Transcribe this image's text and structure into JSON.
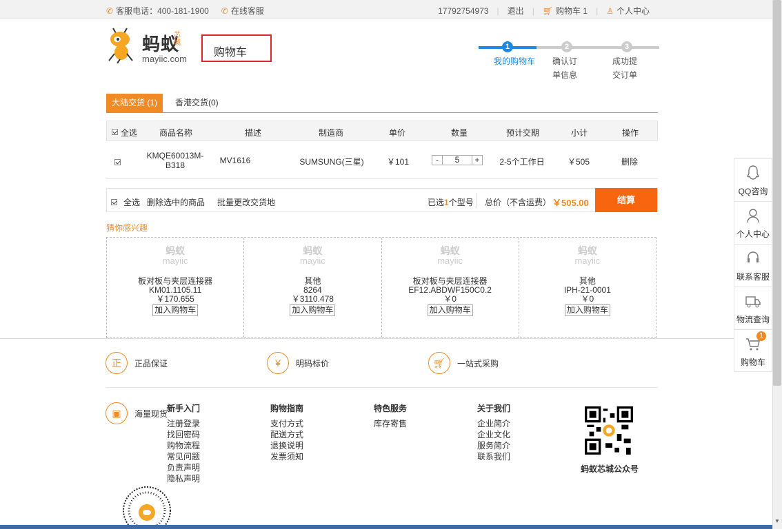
{
  "topbar": {
    "service_phone": "客服电话：400-181-1900",
    "online_service": "在线客服",
    "user_phone": "17792754973",
    "logout": "退出",
    "cart_label": "购物车",
    "cart_count": "1",
    "user_center": "个人中心"
  },
  "logo": {
    "name": "蚂蚁",
    "sub": "芯城",
    "url": "mayiic.com"
  },
  "page_title": "购物车",
  "steps": [
    {
      "num": "1",
      "label": "我的购物车",
      "active": true
    },
    {
      "num": "2",
      "label": "确认订单信息",
      "active": false
    },
    {
      "num": "3",
      "label": "成功提交订单",
      "active": false
    }
  ],
  "tabs": [
    {
      "label": "大陆交货 (1)",
      "active": true
    },
    {
      "label": "香港交货(0)",
      "active": false
    }
  ],
  "table": {
    "headers": [
      "全选",
      "商品名称",
      "描述",
      "制造商",
      "单价",
      "数量",
      "预计交期",
      "小计",
      "操作"
    ],
    "row": {
      "name": "KMQE60013M-B318",
      "desc": "MV1616",
      "maker": "SUMSUNG(三星)",
      "price": "￥101",
      "qty": "5",
      "minus": "-",
      "plus": "+",
      "lead": "2-5个工作日",
      "subtotal": "￥505",
      "action": "删除"
    }
  },
  "footbar": {
    "select_all": "全选",
    "delete_selected": "删除选中的商品",
    "batch_change": "批量更改交货地",
    "selected_prefix": "已选",
    "selected_count": "1",
    "selected_suffix": "个型号",
    "total_label": "总价（不含运费）",
    "total_value": "￥505.00",
    "checkout": "结算"
  },
  "guess_title": "猜你感兴趣",
  "recommendations": [
    {
      "category": "板对板与夹层连接器",
      "model": "KM01.1105.11",
      "price": "￥170.655",
      "button": "加入购物车"
    },
    {
      "category": "其他",
      "model": "8264",
      "price": "￥3110.478",
      "button": "加入购物车"
    },
    {
      "category": "板对板与夹层连接器",
      "model": "EF12.ABDWF150C0.2",
      "price": "￥0",
      "button": "加入购物车"
    },
    {
      "category": "其他",
      "model": "IPH-21-0001",
      "price": "￥0",
      "button": "加入购物车"
    }
  ],
  "features": [
    {
      "icon": "正",
      "label": "正品保证"
    },
    {
      "icon": "¥",
      "label": "明码标价"
    },
    {
      "icon": "cart",
      "label": "一站式采购"
    },
    {
      "icon": "box",
      "label": "海量现货"
    }
  ],
  "footer_cols": [
    {
      "title": "新手入门",
      "links": [
        "注册登录",
        "找回密码",
        "购物流程",
        "常见问题",
        "负责声明",
        "隐私声明"
      ]
    },
    {
      "title": "购物指南",
      "links": [
        "支付方式",
        "配送方式",
        "退换说明",
        "发票须知"
      ]
    },
    {
      "title": "特色服务",
      "links": [
        "库存寄售"
      ]
    },
    {
      "title": "关于我们",
      "links": [
        "企业简介",
        "企业文化",
        "服务简介",
        "联系我们"
      ]
    }
  ],
  "qr_label": "蚂蚁芯城公众号",
  "sidebar": [
    {
      "label": "QQ咨询",
      "icon": "qq-icon"
    },
    {
      "label": "个人中心",
      "icon": "user-icon"
    },
    {
      "label": "联系客服",
      "icon": "headset-icon"
    },
    {
      "label": "物流查询",
      "icon": "truck-icon"
    },
    {
      "label": "购物车",
      "icon": "cart-icon",
      "badge": "1"
    }
  ],
  "colors": {
    "accent": "#f08a24",
    "checkout": "#f7650e",
    "highlight_box": "#d9262a"
  }
}
